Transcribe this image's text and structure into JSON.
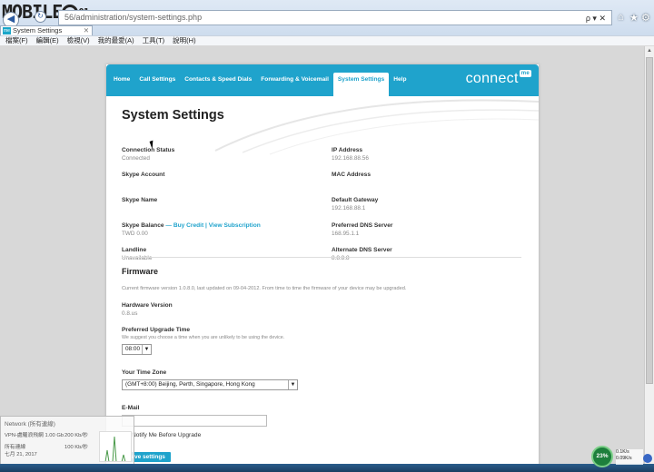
{
  "browser": {
    "logo_text": "MOBILE",
    "logo_suffix": "01",
    "url": "56/administration/system-settings.php",
    "address_tools": "ρ ▾ ✕",
    "tab_title": "System Settings",
    "tab_favicon": "me",
    "menu": [
      "檔案(F)",
      "編輯(E)",
      "檢視(V)",
      "我的最愛(A)",
      "工具(T)",
      "說明(H)"
    ]
  },
  "nav": {
    "items": [
      "Home",
      "Call Settings",
      "Contacts & Speed Dials",
      "Forwarding & Voicemail",
      "System Settings",
      "Help"
    ],
    "active": "System Settings",
    "brand": "connect",
    "brand_badge": "me"
  },
  "page": {
    "title": "System Settings",
    "left": [
      {
        "label": "Connection Status",
        "value": "Connected"
      },
      {
        "label": "Skype Account",
        "value": ""
      },
      {
        "label": "Skype Name",
        "value": ""
      },
      {
        "label": "Skype Balance",
        "link_buy": "Buy Credit",
        "divider": "|",
        "link_view": "View Subscription",
        "value": "TWD 0.00"
      },
      {
        "label": "Landline",
        "value": "Unavailable"
      }
    ],
    "right": [
      {
        "label": "IP Address",
        "value": "192.168.88.56"
      },
      {
        "label": "MAC Address",
        "value": ""
      },
      {
        "label": "Default Gateway",
        "value": "192.168.88.1"
      },
      {
        "label": "Preferred DNS Server",
        "value": "168.95.1.1"
      },
      {
        "label": "Alternate DNS Server",
        "value": "8.8.8.8"
      }
    ],
    "balance_dash": "—"
  },
  "firmware": {
    "heading": "Firmware",
    "description": "Current firmware version 1.0.8.0, last updated on 09-04-2012. From time to time the firmware of your device may be upgraded.",
    "hardware_label": "Hardware Version",
    "hardware_value": "0.8.us",
    "upgrade_label": "Preferred Upgrade Time",
    "upgrade_hint": "We suggest you choose a time when you are unlikely to be using the device.",
    "upgrade_time": "08:00",
    "timezone_label": "Your Time Zone",
    "timezone_value": "(GMT+8:00) Beijing, Perth, Singapore, Hong Kong",
    "email_label": "E-Mail",
    "email_value": "",
    "notify_label": "Notify Me Before Upgrade",
    "save_label": "Save settings"
  },
  "network_overlay": {
    "title": "Network (所有連線)",
    "row1_name": "VPN-處羅浪飛網 1.00 Gb",
    "row1_speed": "200 Kb/秒",
    "row2_name": "所有連線",
    "row2_speed": "100 Kb/秒",
    "row3_name": "七月 21, 2017"
  },
  "system_tray": {
    "net_percent": "23%",
    "up": "0.1K/s",
    "down": "0.09K/s"
  }
}
